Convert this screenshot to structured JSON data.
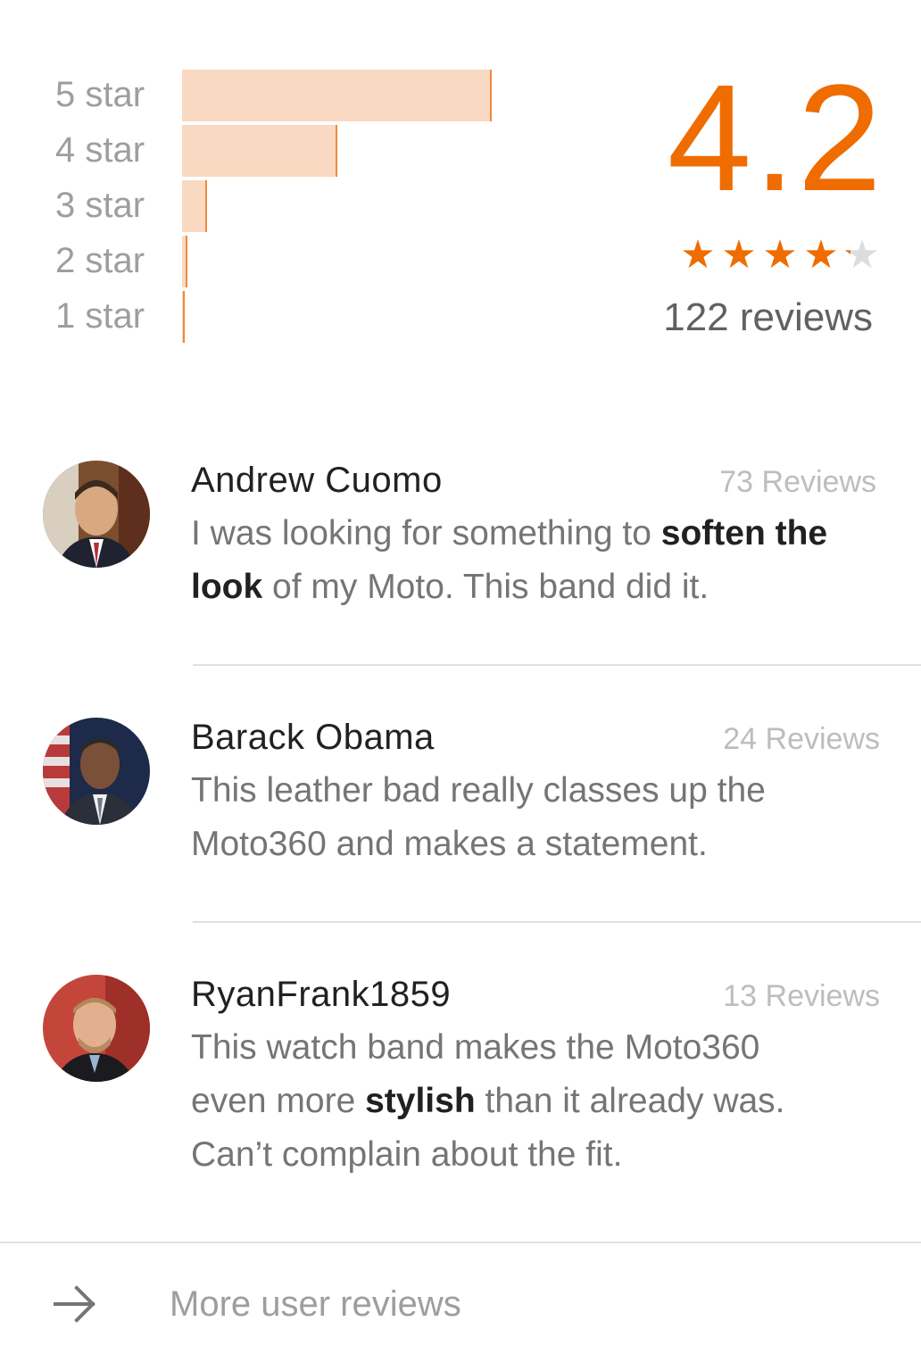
{
  "rating_distribution": {
    "rows": [
      {
        "label": "5 star",
        "share": 0.62
      },
      {
        "label": "4 star",
        "share": 0.31
      },
      {
        "label": "3 star",
        "share": 0.05
      },
      {
        "label": "2 star",
        "share": 0.01
      },
      {
        "label": "1 star",
        "share": 0.004
      }
    ],
    "bar_color": "#f9d9c1",
    "bar_edge_color": "#f08a3c"
  },
  "summary": {
    "average": "4.2",
    "stars_value": 4.2,
    "star_count": 5,
    "total_reviews": "122 reviews",
    "accent_color": "#ef6c00"
  },
  "reviews": [
    {
      "name": "Andrew Cuomo",
      "review_count": "73 Reviews",
      "text_parts": [
        "I was looking for something to ",
        "soften the look",
        " of my Moto. This band did it."
      ],
      "avatar": "portrait-man-suit-icon"
    },
    {
      "name": "Barack Obama",
      "review_count": "24 Reviews",
      "text_parts": [
        "This leather bad really classes up the Moto360 and makes a statement."
      ],
      "avatar": "portrait-man-flag-icon"
    },
    {
      "name": "RyanFrank1859",
      "review_count": "13 Reviews",
      "text_parts": [
        "This watch band makes the Moto360 even more ",
        "stylish",
        " than it already was. Can’t complain about the fit."
      ],
      "avatar": "portrait-man-red-icon"
    }
  ],
  "footer": {
    "more_label": "More user reviews",
    "icon": "arrow-right-icon"
  }
}
